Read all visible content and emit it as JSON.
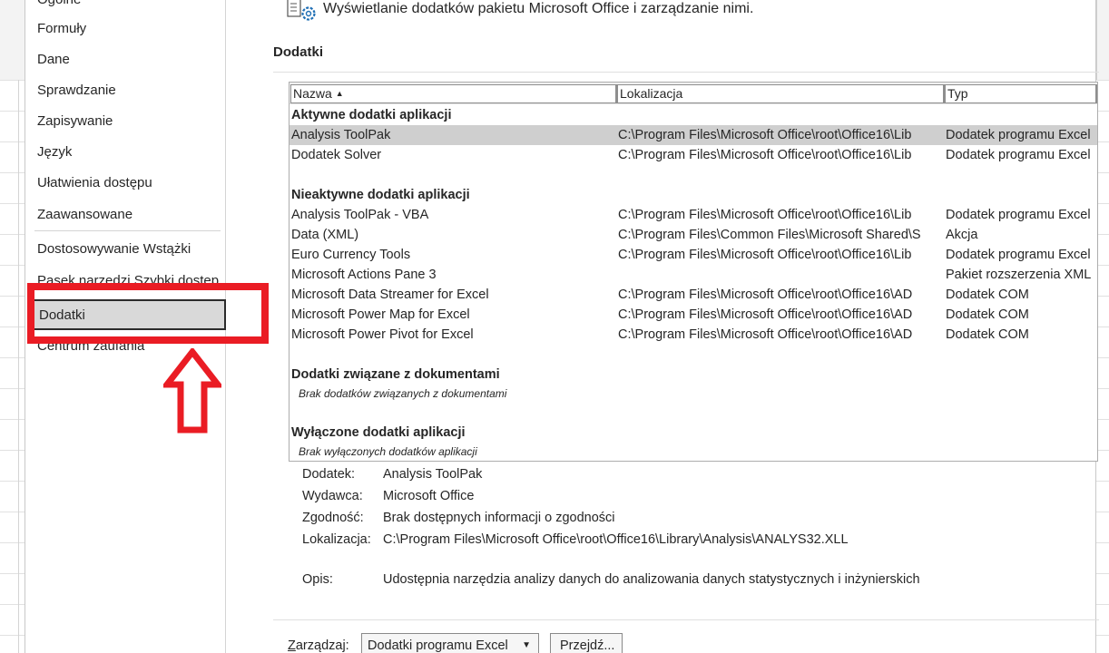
{
  "nav": {
    "items": [
      {
        "label": "Ogólne"
      },
      {
        "label": "Formuły"
      },
      {
        "label": "Dane"
      },
      {
        "label": "Sprawdzanie"
      },
      {
        "label": "Zapisywanie"
      },
      {
        "label": "Język"
      },
      {
        "label": "Ułatwienia dostępu"
      },
      {
        "label": "Zaawansowane"
      },
      {
        "label": "Dostosowywanie Wstążki"
      },
      {
        "label": "Pasek narzędzi Szybki dostęp"
      },
      {
        "label": "Dodatki"
      },
      {
        "label": "Centrum zaufania"
      }
    ],
    "selected": "Dodatki"
  },
  "header": {
    "text": "Wyświetlanie dodatków pakietu Microsoft Office i zarządzanie nimi.",
    "icon": "addins-gear-icon"
  },
  "section": {
    "title": "Dodatki"
  },
  "list": {
    "columns": [
      "Nazwa",
      "Lokalizacja",
      "Typ"
    ],
    "groups": {
      "active": "Aktywne dodatki aplikacji",
      "inactive": "Nieaktywne dodatki aplikacji",
      "document": "Dodatki związane z dokumentami",
      "document_empty": "Brak dodatków związanych z dokumentami",
      "disabled": "Wyłączone dodatki aplikacji",
      "disabled_empty": "Brak wyłączonych dodatków aplikacji"
    },
    "active_rows": [
      {
        "name": "Analysis ToolPak",
        "location": "C:\\Program Files\\Microsoft Office\\root\\Office16\\Lib",
        "type": "Dodatek programu Excel"
      },
      {
        "name": "Dodatek Solver",
        "location": "C:\\Program Files\\Microsoft Office\\root\\Office16\\Lib",
        "type": "Dodatek programu Excel"
      }
    ],
    "inactive_rows": [
      {
        "name": "Analysis ToolPak - VBA",
        "location": "C:\\Program Files\\Microsoft Office\\root\\Office16\\Lib",
        "type": "Dodatek programu Excel"
      },
      {
        "name": "Data (XML)",
        "location": "C:\\Program Files\\Common Files\\Microsoft Shared\\S",
        "type": "Akcja"
      },
      {
        "name": "Euro Currency Tools",
        "location": "C:\\Program Files\\Microsoft Office\\root\\Office16\\Lib",
        "type": "Dodatek programu Excel"
      },
      {
        "name": "Microsoft Actions Pane 3",
        "location": "",
        "type": "Pakiet rozszerzenia XML"
      },
      {
        "name": "Microsoft Data Streamer for Excel",
        "location": "C:\\Program Files\\Microsoft Office\\root\\Office16\\AD",
        "type": "Dodatek COM"
      },
      {
        "name": "Microsoft Power Map for Excel",
        "location": "C:\\Program Files\\Microsoft Office\\root\\Office16\\AD",
        "type": "Dodatek COM"
      },
      {
        "name": "Microsoft Power Pivot for Excel",
        "location": "C:\\Program Files\\Microsoft Office\\root\\Office16\\AD",
        "type": "Dodatek COM"
      }
    ]
  },
  "details": {
    "addin_label": "Dodatek:",
    "addin_value": "Analysis ToolPak",
    "publisher_label": "Wydawca:",
    "publisher_value": "Microsoft Office",
    "compat_label": "Zgodność:",
    "compat_value": "Brak dostępnych informacji o zgodności",
    "location_label": "Lokalizacja:",
    "location_value": "C:\\Program Files\\Microsoft Office\\root\\Office16\\Library\\Analysis\\ANALYS32.XLL",
    "desc_label": "Opis:",
    "desc_value": "Udostępnia narzędzia analizy danych do analizowania danych statystycznych i inżynierskich"
  },
  "manage": {
    "label_underlined": "Z",
    "label_rest": "arządzaj:",
    "selected": "Dodatki programu Excel",
    "go_label": "Przejdź..."
  },
  "colors": {
    "highlight": "#ea1c24",
    "selection": "#cfcfcf"
  }
}
